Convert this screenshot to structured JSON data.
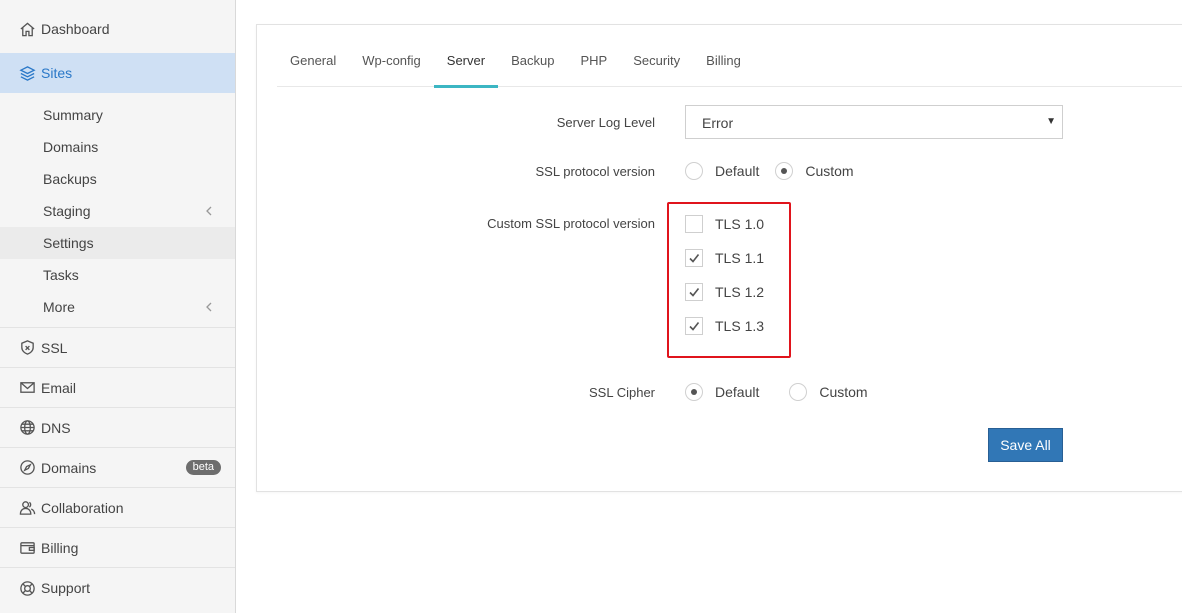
{
  "sidebar": {
    "dashboard": "Dashboard",
    "sites": "Sites",
    "site_items": [
      "Summary",
      "Domains",
      "Backups",
      "Staging",
      "Settings",
      "Tasks",
      "More"
    ],
    "ssl": "SSL",
    "email": "Email",
    "dns": "DNS",
    "domains": "Domains",
    "domains_badge": "beta",
    "collaboration": "Collaboration",
    "billing": "Billing",
    "support": "Support"
  },
  "tabs": [
    "General",
    "Wp-config",
    "Server",
    "Backup",
    "PHP",
    "Security",
    "Billing"
  ],
  "active_tab": "Server",
  "form": {
    "log_level_label": "Server Log Level",
    "log_level_value": "Error",
    "ssl_protocol_label": "SSL protocol version",
    "ssl_protocol_options": [
      "Default",
      "Custom"
    ],
    "ssl_protocol_selected": "Custom",
    "custom_ssl_label": "Custom SSL protocol version",
    "tls_options": [
      {
        "label": "TLS 1.0",
        "checked": false
      },
      {
        "label": "TLS 1.1",
        "checked": true
      },
      {
        "label": "TLS 1.2",
        "checked": true
      },
      {
        "label": "TLS 1.3",
        "checked": true
      }
    ],
    "cipher_label": "SSL Cipher",
    "cipher_options": [
      "Default",
      "Custom"
    ],
    "cipher_selected": "Default"
  },
  "save_label": "Save All",
  "colors": {
    "accent": "#2a78c8",
    "tab_underline": "#3cb6c3",
    "highlight_box": "#e0141c",
    "save_button": "#3177b6"
  }
}
